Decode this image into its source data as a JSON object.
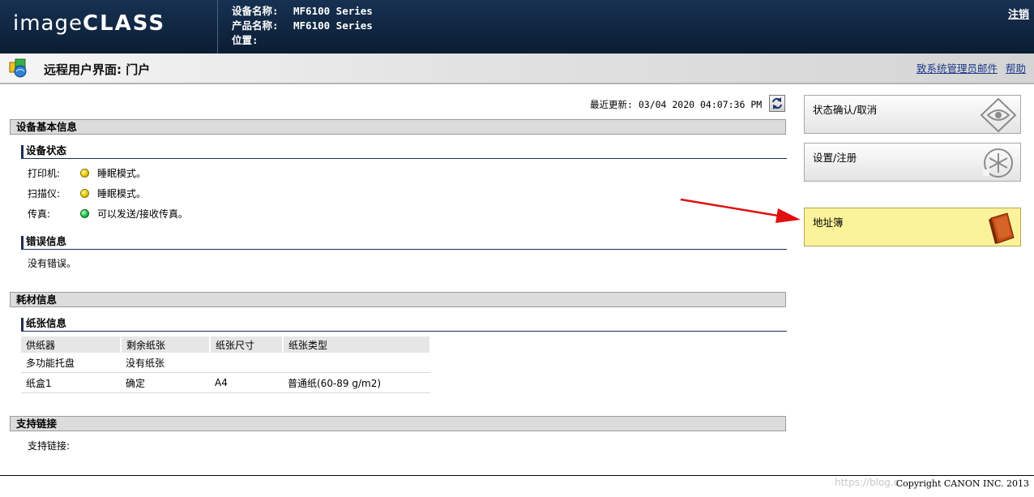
{
  "header": {
    "logo_main": "image",
    "logo_rest": "CLASS",
    "device_name_label": "设备名称:",
    "device_name": "MF6100  Series",
    "product_name_label": "产品名称:",
    "product_name": "MF6100  Series",
    "location_label": "位置:",
    "location": "",
    "logout": "注销"
  },
  "subbar": {
    "title": "远程用户界面: 门户",
    "mail_admin": "致系统管理员邮件",
    "help": "帮助"
  },
  "updated": {
    "text": "最近更新: 03/04  2020  04:07:36  PM"
  },
  "sections": {
    "basic_info": "设备基本信息",
    "device_status": "设备状态",
    "error_info": "错误信息",
    "consumables": "耗材信息",
    "paper_info": "纸张信息",
    "support": "支持链接"
  },
  "status": {
    "printer_label": "打印机:",
    "printer_value": "睡眠模式。",
    "scanner_label": "扫描仪:",
    "scanner_value": "睡眠模式。",
    "fax_label": "传真:",
    "fax_value": "可以发送/接收传真。",
    "colors": {
      "sleep": "#e8c800",
      "ready": "#1bbf4a"
    }
  },
  "errors": {
    "text": "没有错误。"
  },
  "paper_table": {
    "headers": [
      "供纸器",
      "剩余纸张",
      "纸张尺寸",
      "纸张类型"
    ],
    "rows": [
      [
        "多功能托盘",
        "没有纸张",
        "",
        ""
      ],
      [
        "纸盒1",
        "确定",
        "A4",
        "普通纸(60-89 g/m2)"
      ]
    ]
  },
  "support": {
    "label": "支持链接:"
  },
  "menu": {
    "status_cancel": "状态确认/取消",
    "settings": "设置/注册",
    "address_book": "地址簿"
  },
  "footer": {
    "copyright": "Copyright CANON INC. 2013",
    "watermark": "https://blog.c"
  }
}
